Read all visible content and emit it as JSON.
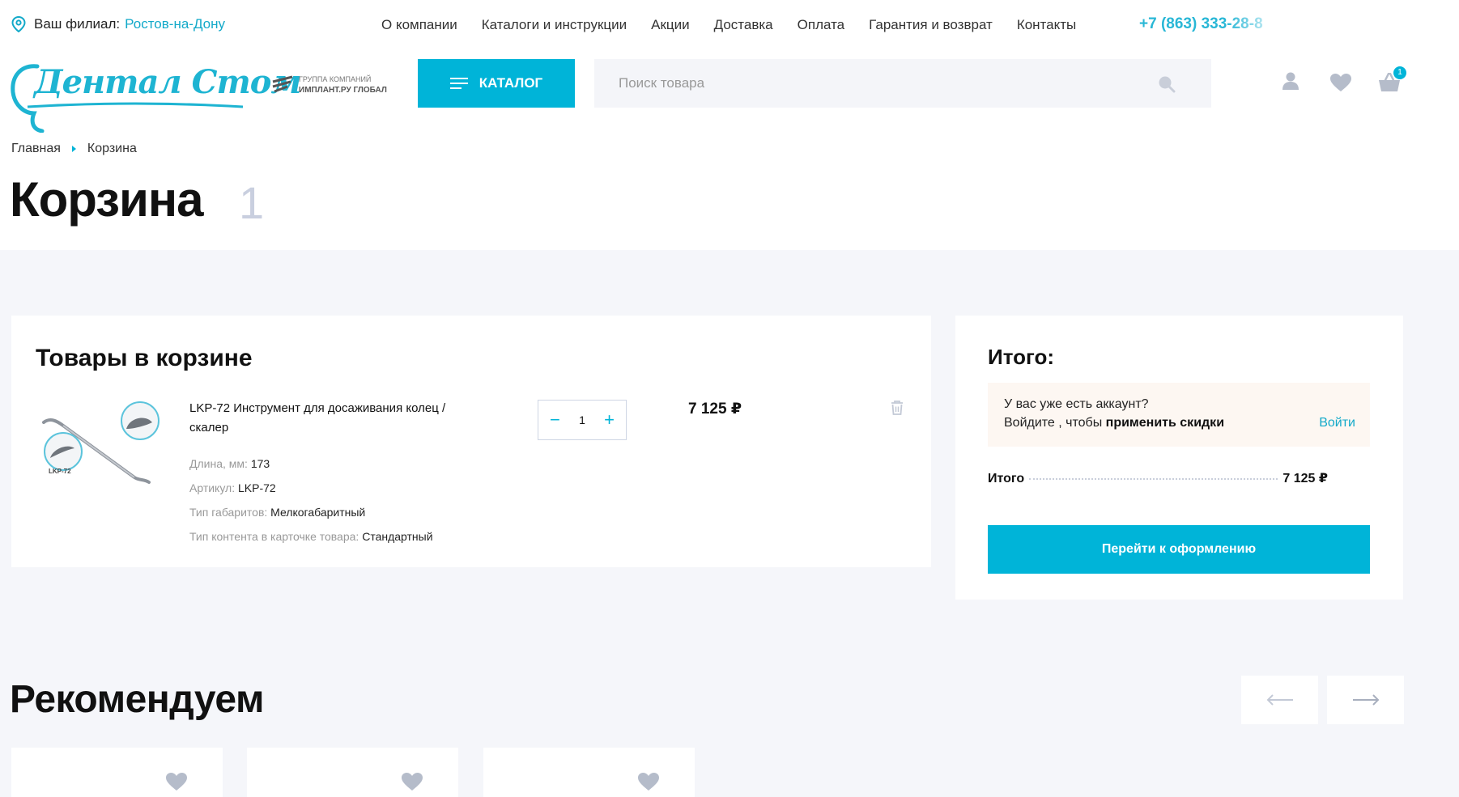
{
  "topbar": {
    "branch_label": "Ваш филиал:",
    "branch_city": "Ростов-на-Дону",
    "nav": [
      "О компании",
      "Каталоги и инструкции",
      "Акции",
      "Доставка",
      "Оплата",
      "Гарантия и возврат",
      "Контакты"
    ],
    "phone": "+7 (863) 333-28-8"
  },
  "header": {
    "logo_text": "Дентал Стом",
    "group_line1": "ГРУППА КОМПАНИЙ",
    "group_line2": "ИМПЛАНТ.РУ ГЛОБАЛ",
    "catalog_label": "КАТАЛОГ",
    "search_placeholder": "Поиск товара",
    "cart_count": "1"
  },
  "breadcrumb": {
    "home": "Главная",
    "current": "Корзина"
  },
  "page": {
    "title": "Корзина",
    "count": "1"
  },
  "cart": {
    "heading": "Товары в корзине",
    "item": {
      "image_label": "LKP-72",
      "name": "LKP-72 Инструмент для досаживания колец / скалер",
      "props": [
        {
          "label": "Длина, мм:",
          "value": "173"
        },
        {
          "label": "Артикул:",
          "value": "LKP-72"
        },
        {
          "label": "Тип габаритов:",
          "value": "Мелкогабаритный"
        },
        {
          "label": "Тип контента в карточке товара:",
          "value": "Стандартный"
        }
      ],
      "qty": "1",
      "price": "7 125 ₽"
    }
  },
  "summary": {
    "heading": "Итого:",
    "account_line1": "У вас уже есть аккаунт?",
    "account_line2_prefix": "Войдите , чтобы ",
    "account_line2_bold": "применить скидки",
    "login_link": "Войти",
    "total_label": "Итого",
    "total_value": "7 125 ₽",
    "checkout_label": "Перейти к оформлению"
  },
  "recommend": {
    "heading": "Рекомендуем"
  },
  "colors": {
    "accent": "#00b4d8",
    "link": "#12a9c9",
    "gray_bg": "#f5f6fa"
  }
}
